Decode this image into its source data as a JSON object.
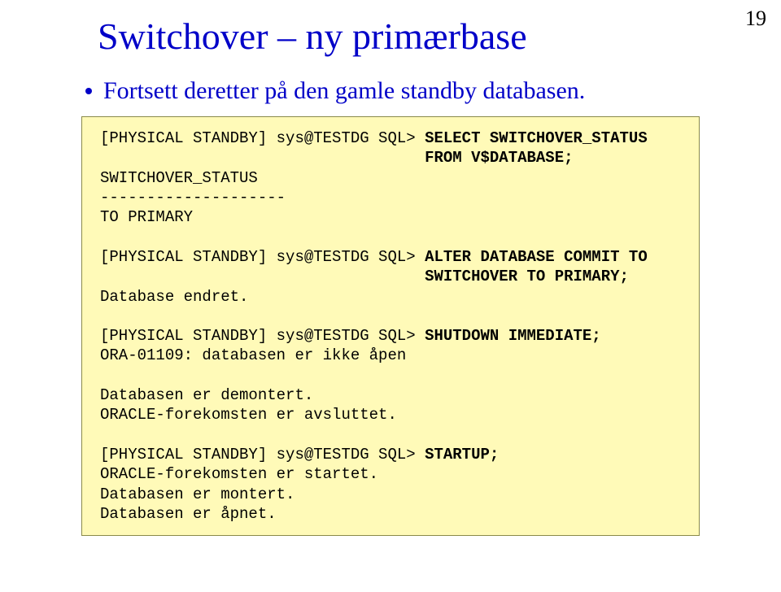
{
  "page_number": "19",
  "title": "Switchover – ny primærbase",
  "bullet": "Fortsett deretter på den gamle standby databasen.",
  "code": {
    "l01a": "[PHYSICAL STANDBY] sys@TESTDG SQL> ",
    "l01b": "SELECT SWITCHOVER_STATUS",
    "l02a": "                                   ",
    "l02b": "FROM V$DATABASE;",
    "l03": "SWITCHOVER_STATUS",
    "l04": "--------------------",
    "l05": "TO PRIMARY",
    "blank1": " ",
    "l06a": "[PHYSICAL STANDBY] sys@TESTDG SQL> ",
    "l06b": "ALTER DATABASE COMMIT TO",
    "l07a": "                                   ",
    "l07b": "SWITCHOVER TO PRIMARY;",
    "l08": "Database endret.",
    "blank2": " ",
    "l09a": "[PHYSICAL STANDBY] sys@TESTDG SQL> ",
    "l09b": "SHUTDOWN IMMEDIATE;",
    "l10": "ORA-01109: databasen er ikke åpen",
    "blank3": " ",
    "l11": "Databasen er demontert.",
    "l12": "ORACLE-forekomsten er avsluttet.",
    "blank4": " ",
    "l13a": "[PHYSICAL STANDBY] sys@TESTDG SQL> ",
    "l13b": "STARTUP;",
    "l14": "ORACLE-forekomsten er startet.",
    "l15": "Databasen er montert.",
    "l16": "Databasen er åpnet."
  }
}
